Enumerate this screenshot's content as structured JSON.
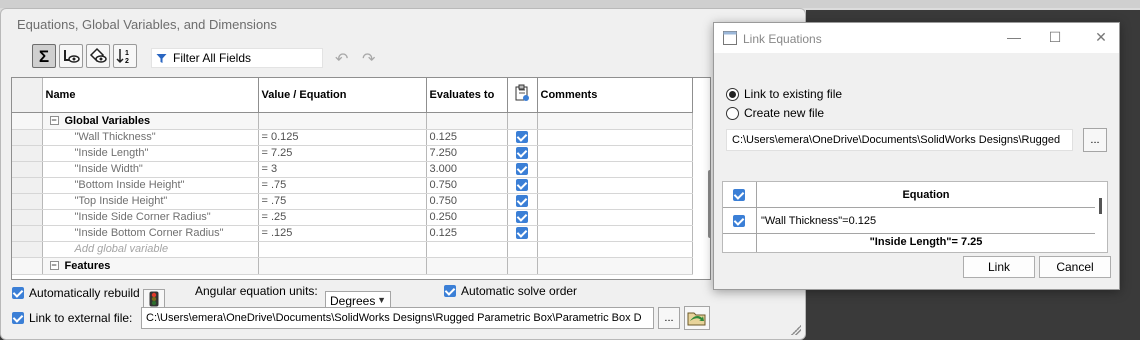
{
  "equations_dialog": {
    "title": "Equations, Global Variables, and Dimensions",
    "toolbar": {
      "buttons": [
        "equation-view-icon",
        "sketch-equation-view-icon",
        "dimension-view-icon",
        "ordered-view-icon"
      ],
      "filter_placeholder": "Filter All Fields",
      "undo_icon": "undo-icon",
      "redo_icon": "redo-icon"
    },
    "table": {
      "columns": [
        "Name",
        "Value / Equation",
        "Evaluates to",
        "",
        "Comments"
      ],
      "sections": {
        "global": "Global Variables",
        "features": "Features"
      },
      "rows": [
        {
          "name": "\"Wall Thickness\"",
          "value": "= 0.125",
          "evaluates": "0.125"
        },
        {
          "name": "\"Inside Length\"",
          "value": "= 7.25",
          "evaluates": "7.250"
        },
        {
          "name": "\"Inside Width\"",
          "value": "= 3",
          "evaluates": "3.000"
        },
        {
          "name": "\"Bottom Inside Height\"",
          "value": "= .75",
          "evaluates": "0.750"
        },
        {
          "name": "\"Top Inside Height\"",
          "value": "= .75",
          "evaluates": "0.750"
        },
        {
          "name": "\"Inside Side Corner Radius\"",
          "value": "= .25",
          "evaluates": "0.250"
        },
        {
          "name": "\"Inside Bottom Corner Radius\"",
          "value": "= .125",
          "evaluates": "0.125"
        }
      ],
      "add_placeholder": "Add global variable"
    },
    "options": {
      "auto_rebuild": "Automatically rebuild",
      "angular_units_label": "Angular equation units:",
      "angular_units_value": "Degrees",
      "auto_solve": "Automatic solve order",
      "link_external": "Link to external file:",
      "external_path": "C:\\Users\\emera\\OneDrive\\Documents\\SolidWorks Designs\\Rugged Parametric Box\\Parametric Box D",
      "browse": "..."
    }
  },
  "link_dialog": {
    "title": "Link Equations",
    "option_existing": "Link to existing file",
    "option_new": "Create new file",
    "path": "C:\\Users\\emera\\OneDrive\\Documents\\SolidWorks Designs\\Rugged",
    "browse": "...",
    "table": {
      "header": "Equation",
      "row1": "\"Wall Thickness\"=0.125",
      "row2": "\"Inside Length\"= 7.25"
    },
    "link_button": "Link",
    "cancel_button": "Cancel"
  }
}
